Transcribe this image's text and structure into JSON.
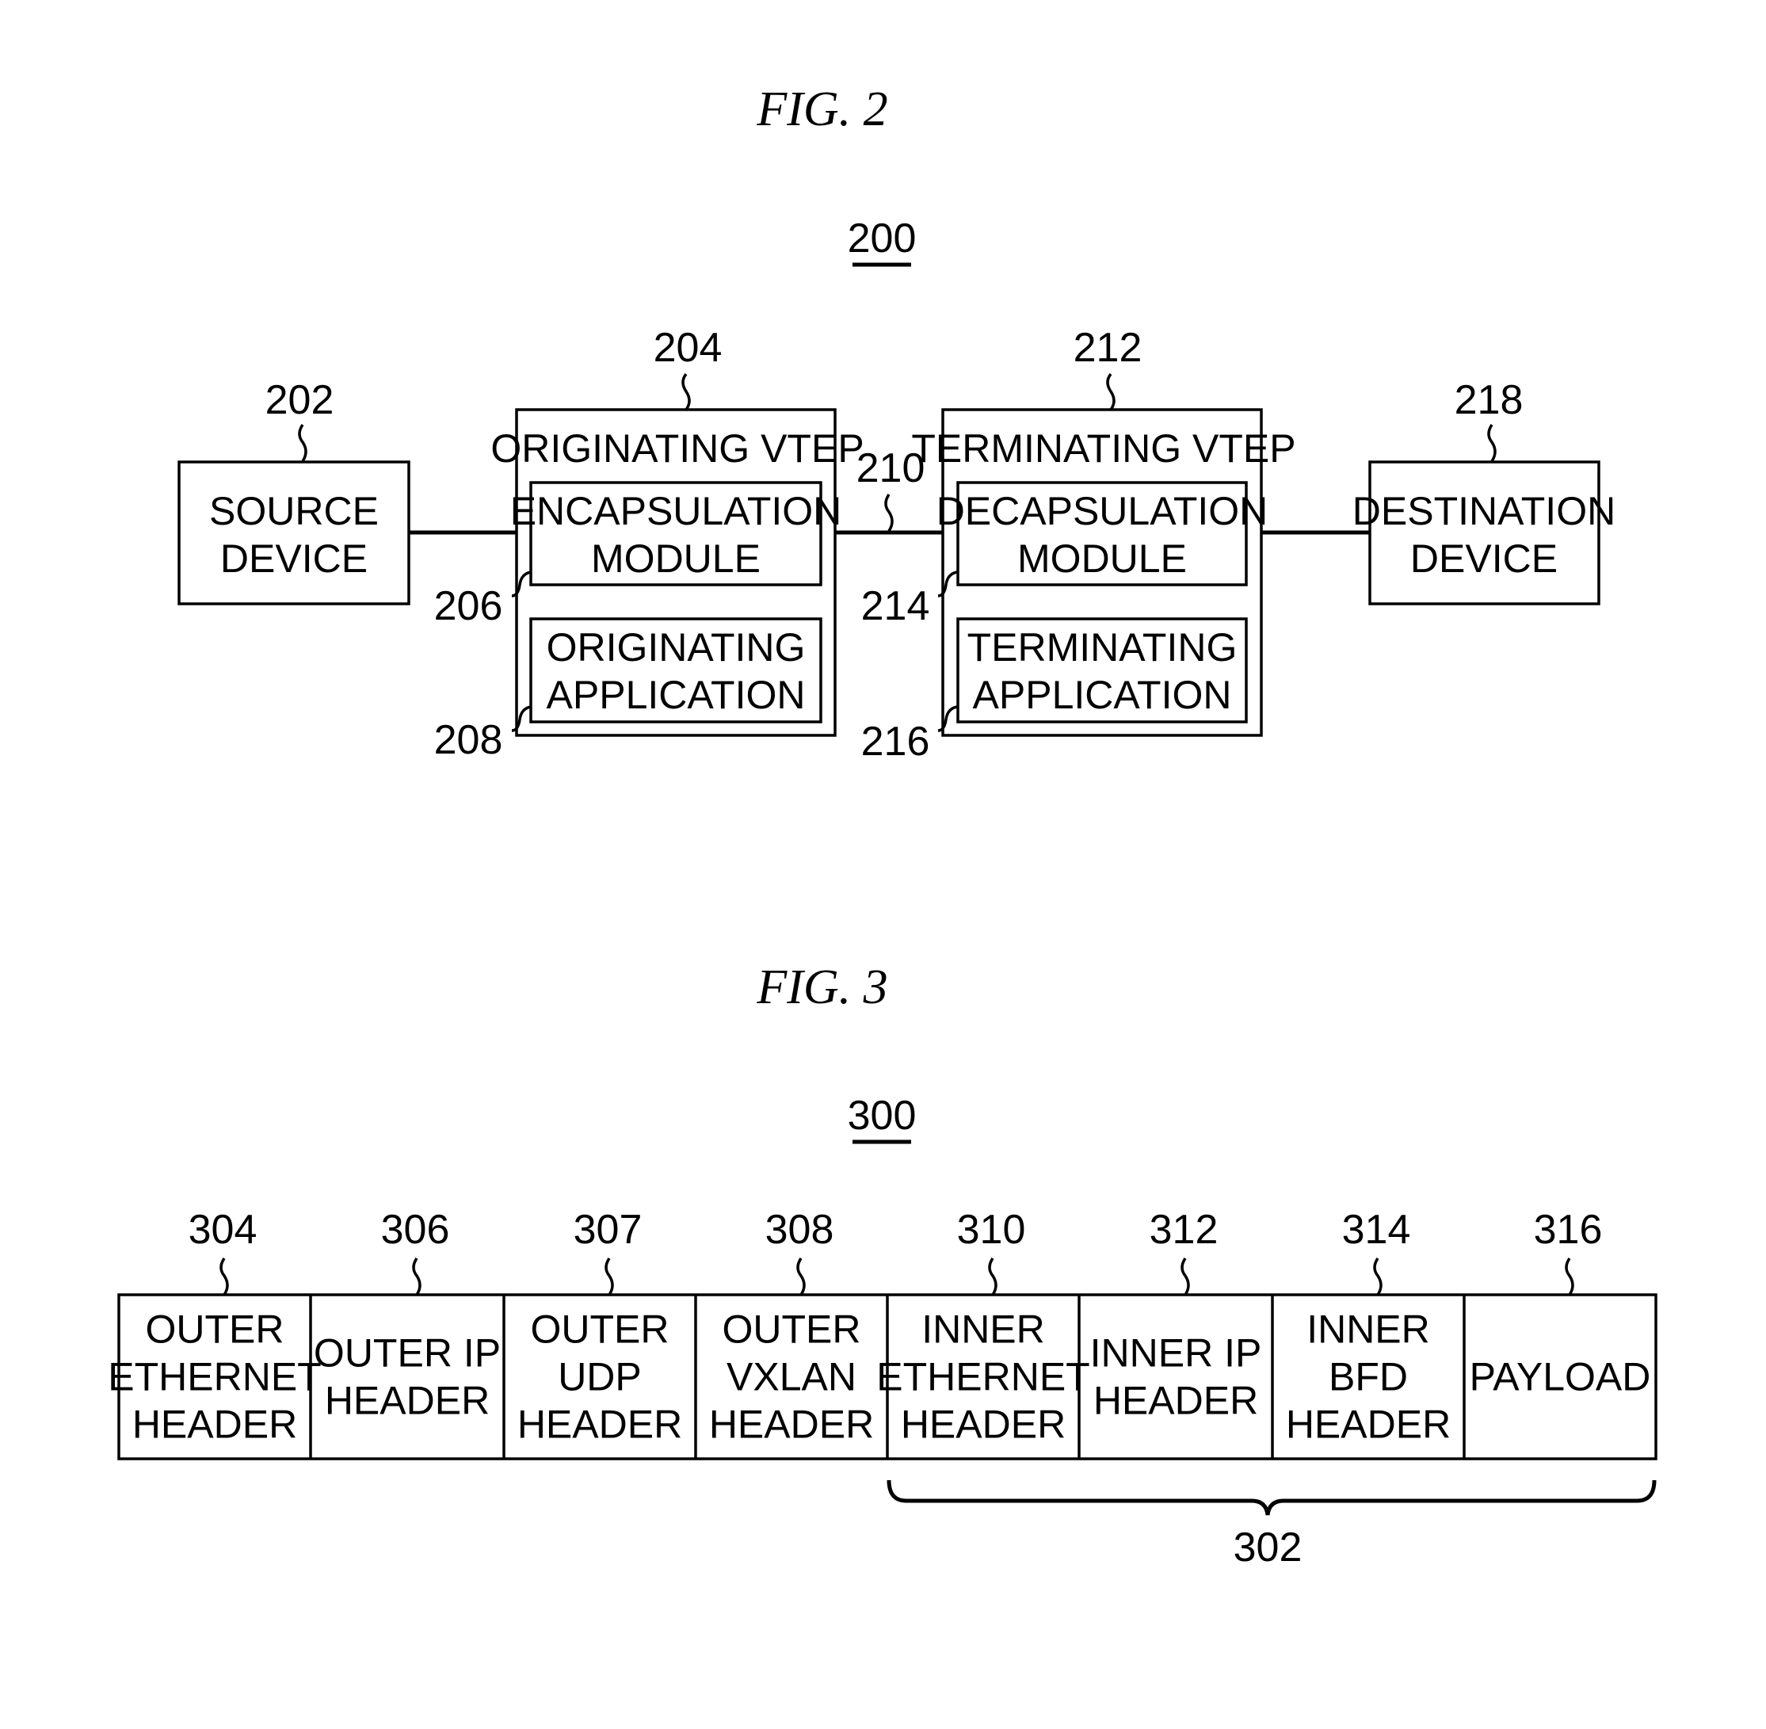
{
  "fig2": {
    "title": "FIG.   2",
    "ref": "200",
    "source_device": {
      "ref": "202",
      "lines": [
        "SOURCE",
        "DEVICE"
      ]
    },
    "originating_vtep": {
      "ref": "204",
      "title": "ORIGINATING  VTEP",
      "encapsulation_module": {
        "ref": "206",
        "lines": [
          "ENCAPSULATION",
          "MODULE"
        ]
      },
      "originating_application": {
        "ref": "208",
        "lines": [
          "ORIGINATING",
          "APPLICATION"
        ]
      }
    },
    "link": {
      "ref": "210"
    },
    "terminating_vtep": {
      "ref": "212",
      "title": "TERMINATING  VTEP",
      "decapsulation_module": {
        "ref": "214",
        "lines": [
          "DECAPSULATION",
          "MODULE"
        ]
      },
      "terminating_application": {
        "ref": "216",
        "lines": [
          "TERMINATING",
          "APPLICATION"
        ]
      }
    },
    "destination_device": {
      "ref": "218",
      "lines": [
        "DESTINATION",
        "DEVICE"
      ]
    }
  },
  "fig3": {
    "title": "FIG.   3",
    "ref": "300",
    "fields": [
      {
        "ref": "304",
        "lines": [
          "OUTER",
          "ETHERNET",
          "HEADER"
        ]
      },
      {
        "ref": "306",
        "lines": [
          "OUTER  IP",
          "HEADER"
        ]
      },
      {
        "ref": "307",
        "lines": [
          "OUTER",
          "UDP",
          "HEADER"
        ]
      },
      {
        "ref": "308",
        "lines": [
          "OUTER",
          "VXLAN",
          "HEADER"
        ]
      },
      {
        "ref": "310",
        "lines": [
          "INNER",
          "ETHERNET",
          "HEADER"
        ]
      },
      {
        "ref": "312",
        "lines": [
          "INNER  IP",
          "HEADER"
        ]
      },
      {
        "ref": "314",
        "lines": [
          "INNER",
          "BFD",
          "HEADER"
        ]
      },
      {
        "ref": "316",
        "lines": [
          "PAYLOAD"
        ]
      }
    ],
    "brace": {
      "ref": "302"
    }
  }
}
